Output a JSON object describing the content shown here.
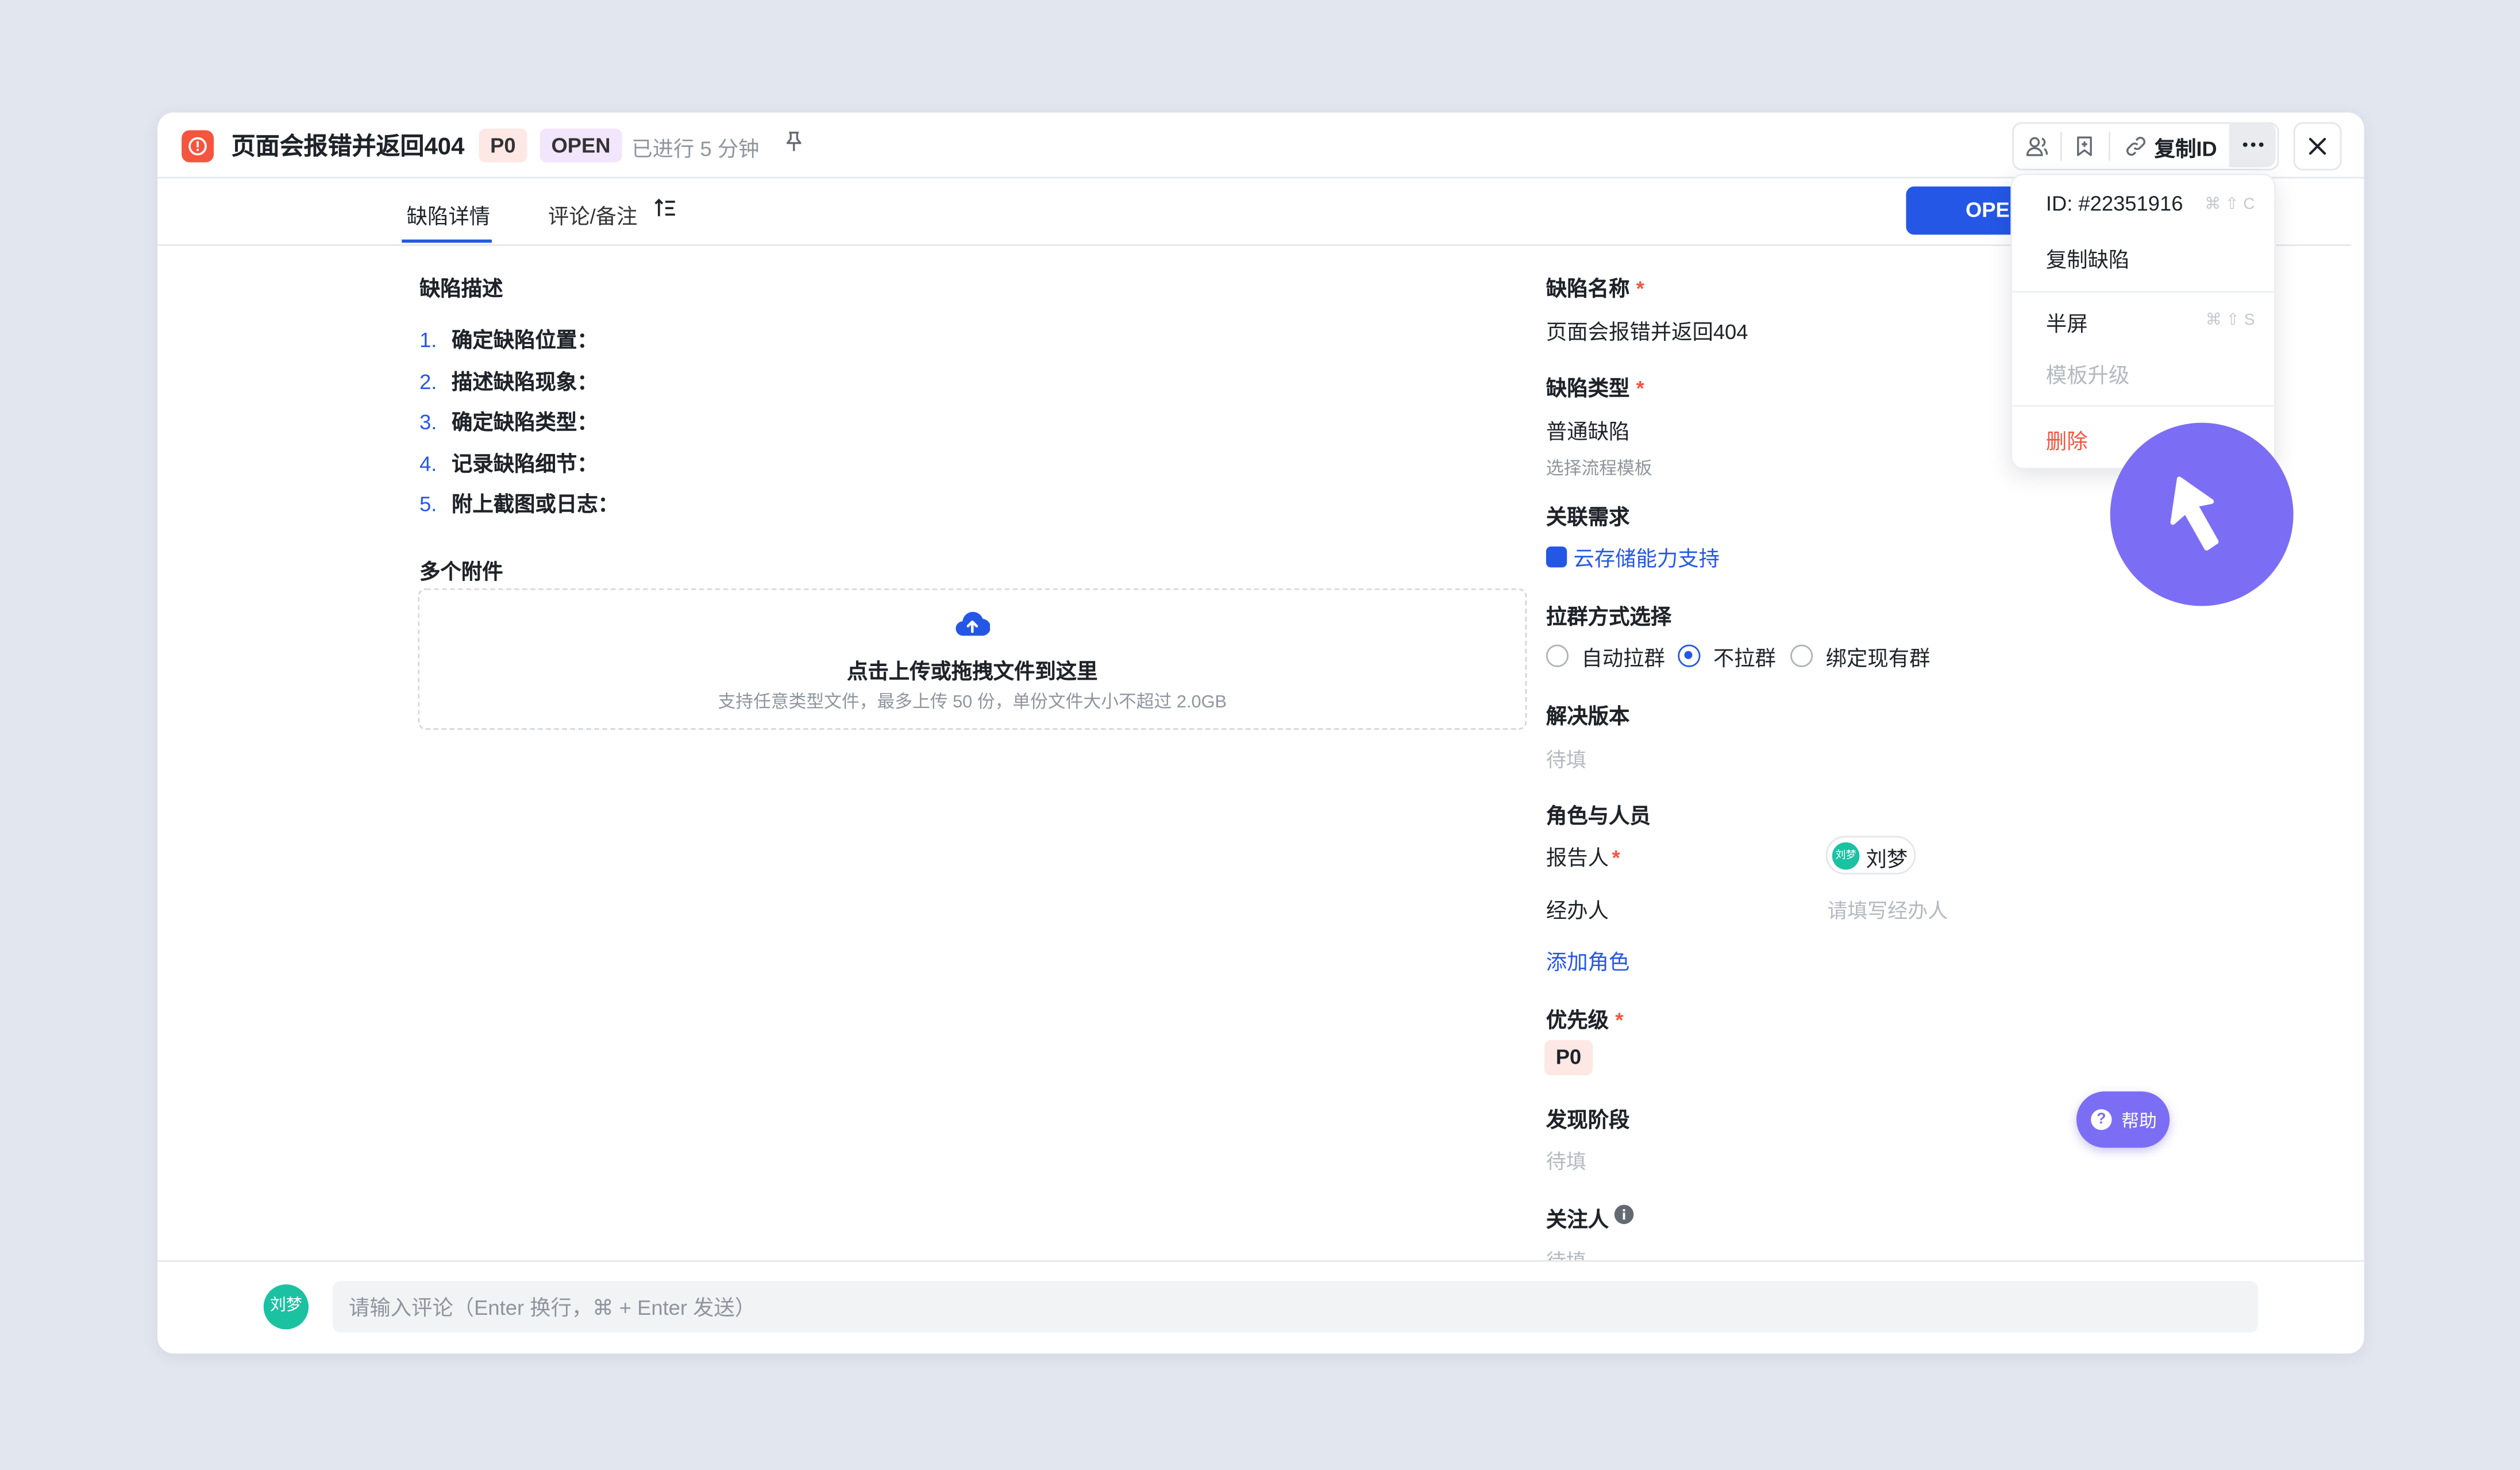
{
  "header": {
    "title": "页面会报错并返回404",
    "priority_badge": "P0",
    "status_badge": "OPEN",
    "elapsed": "已进行 5 分钟",
    "copy_id_label": "复制ID"
  },
  "tabs": {
    "detail": "缺陷详情",
    "comments": "评论/备注"
  },
  "status_button": "OPEN",
  "left": {
    "description_label": "缺陷描述",
    "steps": [
      {
        "num": "1.",
        "text": "确定缺陷位置："
      },
      {
        "num": "2.",
        "text": "描述缺陷现象："
      },
      {
        "num": "3.",
        "text": "确定缺陷类型："
      },
      {
        "num": "4.",
        "text": "记录缺陷细节："
      },
      {
        "num": "5.",
        "text": "附上截图或日志："
      }
    ],
    "attachments_label": "多个附件",
    "upload_title": "点击上传或拖拽文件到这里",
    "upload_hint": "支持任意类型文件，最多上传 50 份，单份文件大小不超过 2.0GB"
  },
  "right": {
    "name_label": "缺陷名称",
    "name_value": "页面会报错并返回404",
    "type_label": "缺陷类型",
    "type_value": "普通缺陷",
    "template_hint": "选择流程模板",
    "linked_label": "关联需求",
    "linked_value": "云存储能力支持",
    "group_label": "拉群方式选择",
    "group_options": [
      "自动拉群",
      "不拉群",
      "绑定现有群"
    ],
    "group_selected": "不拉群",
    "version_label": "解决版本",
    "version_placeholder": "待填",
    "roles_label": "角色与人员",
    "reporter_label": "报告人",
    "reporter_name": "刘梦",
    "reporter_avatar": "刘梦",
    "assignee_label": "经办人",
    "assignee_placeholder": "请填写经办人",
    "add_role": "添加角色",
    "priority_label": "优先级",
    "priority_value": "P0",
    "stage_label": "发现阶段",
    "stage_placeholder": "待填",
    "watchers_label": "关注人",
    "watchers_placeholder": "待填"
  },
  "menu": {
    "id_label": "ID: #22351916",
    "id_shortcut": "⌘ ⇧ C",
    "copy_bug": "复制缺陷",
    "half_screen": "半屏",
    "half_shortcut": "⌘ ⇧ S",
    "template_upgrade": "模板升级",
    "delete": "删除"
  },
  "help": "帮助",
  "footer": {
    "avatar": "刘梦",
    "comment_placeholder": "请输入评论（Enter 换行，⌘ + Enter 发送）"
  },
  "colors": {
    "accent": "#2457e6",
    "danger": "#f5553f",
    "help": "#7c6ef4",
    "avatar": "#1bc2a2"
  },
  "icons": [
    "bug-icon",
    "pin-icon",
    "members-icon",
    "bookmark-icon",
    "link-icon",
    "more-icon",
    "close-icon",
    "sort-icon",
    "upload-cloud-icon",
    "requirement-icon",
    "info-icon",
    "help-icon",
    "cursor-arrow-icon"
  ]
}
